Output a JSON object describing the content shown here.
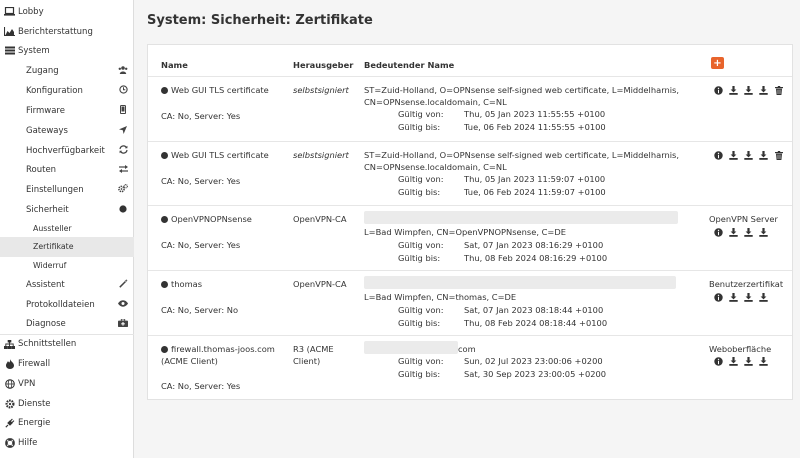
{
  "sidebar": {
    "lobby": "Lobby",
    "reporting": "Berichterstattung",
    "system": "System",
    "access": "Zugang",
    "configuration": "Konfiguration",
    "firmware": "Firmware",
    "gateways": "Gateways",
    "ha": "Hochverfügbarkeit",
    "routes": "Routen",
    "settings": "Einstellungen",
    "security": "Sicherheit",
    "issuer": "Aussteller",
    "certificates": "Zertifikate",
    "revocation": "Widerruf",
    "wizard": "Assistent",
    "logs": "Protokolldateien",
    "diagnostics": "Diagnose",
    "interfaces": "Schnittstellen",
    "firewall": "Firewall",
    "vpn": "VPN",
    "services": "Dienste",
    "power": "Energie",
    "help": "Hilfe"
  },
  "page": {
    "title": "System: Sicherheit: Zertifikate",
    "add_label": "+"
  },
  "table": {
    "headers": {
      "name": "Name",
      "issuer": "Herausgeber",
      "dn": "Bedeutender Name"
    },
    "valid_from_label": "Gültig von:",
    "valid_to_label": "Gültig bis:",
    "rows": [
      {
        "name": "Web GUI TLS certificate",
        "ca_info": "CA: No, Server: Yes",
        "issuer": "selbstsigniert",
        "dn1": "ST=Zuid-Holland, O=OPNsense self-signed web certificate, L=Middelharnis,",
        "dn2": "CN=OPNsense.localdomain, C=NL",
        "valid_from": "Thu, 05 Jan 2023 11:55:55 +0100",
        "valid_to": "Tue, 06 Feb 2024 11:55:55 +0100",
        "usage": ""
      },
      {
        "name": "Web GUI TLS certificate",
        "ca_info": "CA: No, Server: Yes",
        "issuer": "selbstsigniert",
        "dn1": "ST=Zuid-Holland, O=OPNsense self-signed web certificate, L=Middelharnis,",
        "dn2": "CN=OPNsense.localdomain, C=NL",
        "valid_from": "Thu, 05 Jan 2023 11:59:07 +0100",
        "valid_to": "Tue, 06 Feb 2024 11:59:07 +0100",
        "usage": ""
      },
      {
        "name": "OpenVPNOPNsense",
        "ca_info": "CA: No, Server: Yes",
        "issuer": "OpenVPN-CA",
        "dn1": "",
        "dn2": "L=Bad Wimpfen, CN=OpenVPNOPNsense, C=DE",
        "valid_from": "Sat, 07 Jan 2023 08:16:29 +0100",
        "valid_to": "Thu, 08 Feb 2024 08:16:29 +0100",
        "usage": "OpenVPN Server"
      },
      {
        "name": "thomas",
        "ca_info": "CA: No, Server: No",
        "issuer": "OpenVPN-CA",
        "dn1": "",
        "dn2": "L=Bad Wimpfen, CN=thomas, C=DE",
        "valid_from": "Sat, 07 Jan 2023 08:18:44 +0100",
        "valid_to": "Thu, 08 Feb 2024 08:18:44 +0100",
        "usage": "Benutzerzertifikat"
      },
      {
        "name": "firewall.thomas-joos.com",
        "name2": "(ACME Client)",
        "ca_info": "CA: No, Server: Yes",
        "issuer": "R3 (ACME",
        "issuer2": "Client)",
        "dn1": "com",
        "dn2": "",
        "valid_from": "Sun, 02 Jul 2023 23:00:06 +0200",
        "valid_to": "Sat, 30 Sep 2023 23:00:05 +0200",
        "usage": "Weboberfläche"
      }
    ]
  }
}
